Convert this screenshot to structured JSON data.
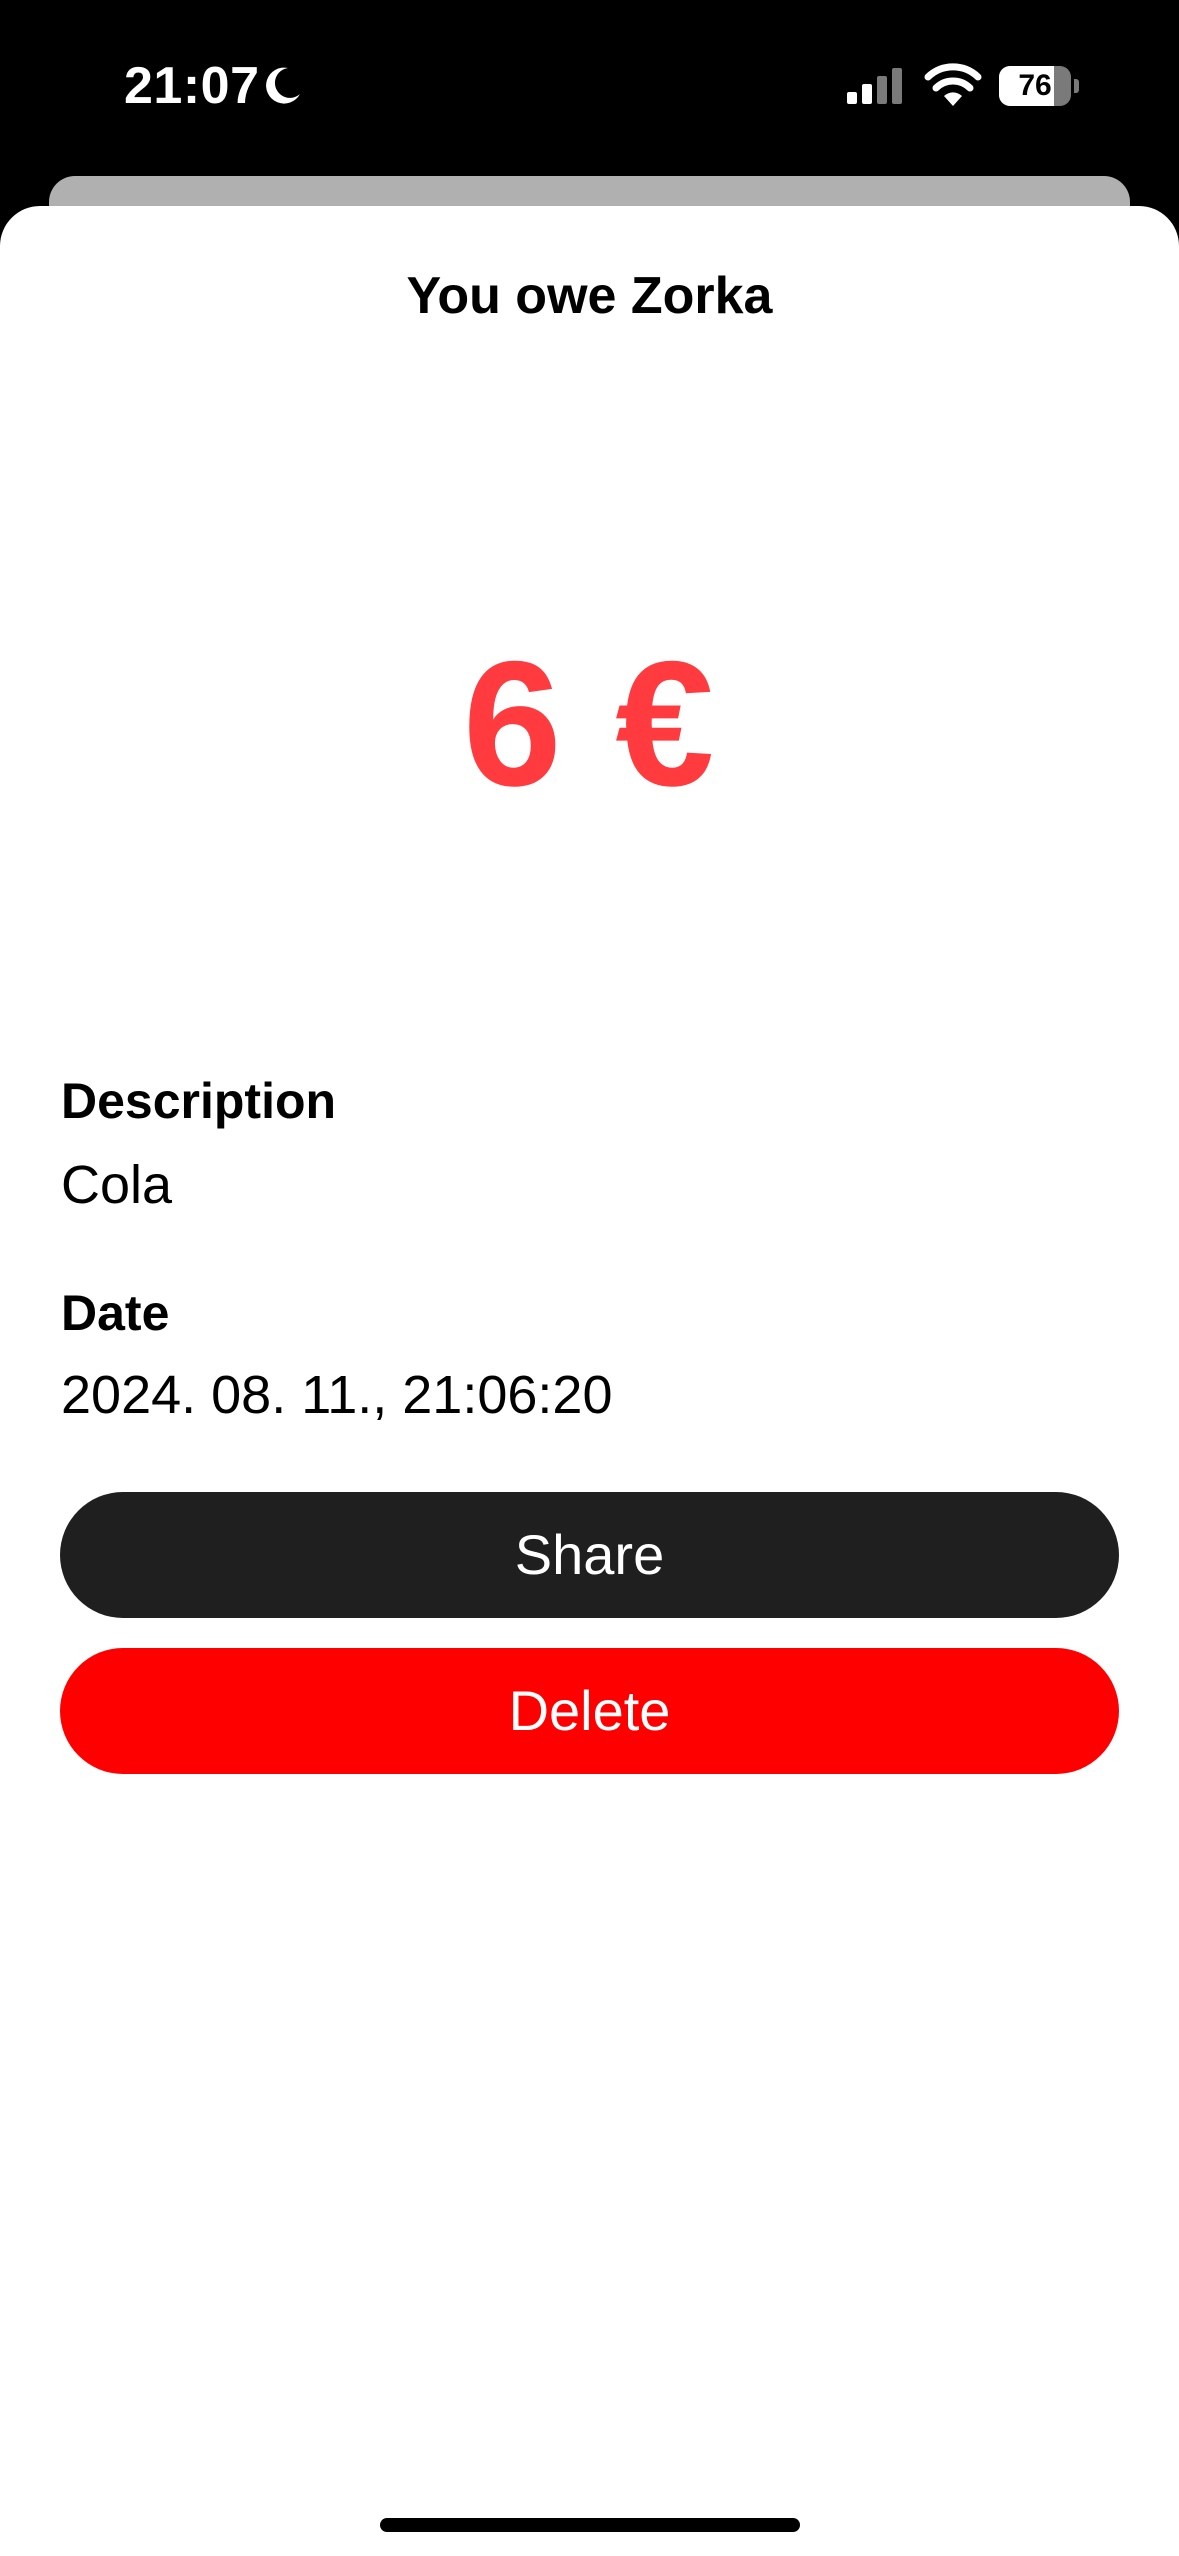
{
  "status_bar": {
    "time": "21:07",
    "battery_level": "76",
    "battery_fraction": 0.76,
    "icons": [
      "moon-icon",
      "signal-icon",
      "wifi-icon",
      "battery-icon"
    ]
  },
  "sheet": {
    "title": "You owe Zorka",
    "amount": "6 €",
    "description_label": "Description",
    "description_value": "Cola",
    "date_label": "Date",
    "date_value": "2024. 08. 11., 21:06:20"
  },
  "actions": {
    "share_label": "Share",
    "delete_label": "Delete"
  },
  "colors": {
    "amount": "#ff3b3f",
    "share_button": "#1f1f1f",
    "delete_button": "#ff0000",
    "sheet_background": "#ffffff",
    "status_bar_background": "#000000"
  }
}
